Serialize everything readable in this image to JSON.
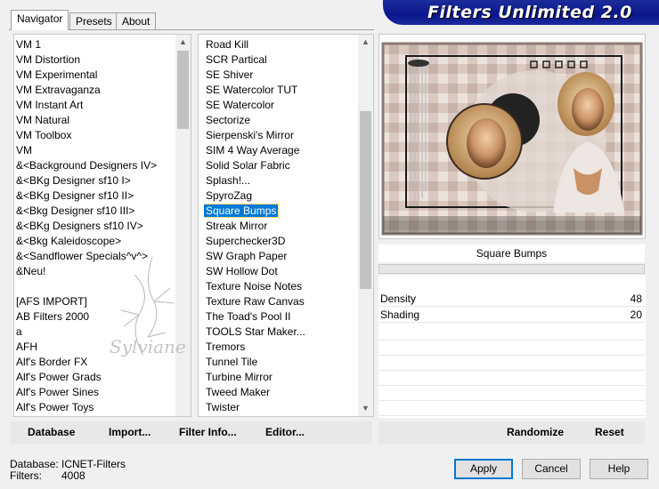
{
  "tabs": [
    "Navigator",
    "Presets",
    "About"
  ],
  "banner": "Filters Unlimited 2.0",
  "categories": [
    "VM 1",
    "VM Distortion",
    "VM Experimental",
    "VM Extravaganza",
    "VM Instant Art",
    "VM Natural",
    "VM Toolbox",
    "VM",
    "&<Background Designers IV>",
    "&<BKg Designer sf10 I>",
    "&<BKg Designer sf10 II>",
    "&<Bkg Designer sf10 III>",
    "&<BKg Designers sf10 IV>",
    "&<Bkg Kaleidoscope>",
    "&<Sandflower Specials^v^>",
    "&Neu!",
    "",
    "[AFS IMPORT]",
    "AB Filters 2000",
    "a",
    "AFH",
    "Alf's Border FX",
    "Alf's Power Grads",
    "Alf's Power Sines",
    "Alf's Power Toys"
  ],
  "filters": [
    "Road Kill",
    "SCR  Partical",
    "SE Shiver",
    "SE Watercolor TUT",
    "SE Watercolor",
    "Sectorize",
    "Sierpenski's Mirror",
    "SIM 4 Way Average",
    "Solid Solar Fabric",
    "Splash!...",
    "SpyroZag",
    "Square Bumps",
    "Streak Mirror",
    "Superchecker3D",
    "SW Graph Paper",
    "SW Hollow Dot",
    "Texture Noise Notes",
    "Texture Raw Canvas",
    "The Toad's Pool II",
    "TOOLS Star Maker...",
    "Tremors",
    "Tunnel Tile",
    "Turbine Mirror",
    "Tweed Maker",
    "Twister"
  ],
  "selected_filter_index": 11,
  "filter_name": "Square Bumps",
  "params": [
    {
      "label": "Density",
      "value": "48"
    },
    {
      "label": "Shading",
      "value": "20"
    }
  ],
  "toolbar": {
    "database": "Database",
    "import": "Import...",
    "filter_info": "Filter Info...",
    "editor": "Editor...",
    "randomize": "Randomize",
    "reset": "Reset"
  },
  "status": {
    "database_label": "Database:",
    "database_value": "ICNET-Filters",
    "filters_label": "Filters:",
    "filters_value": "4008"
  },
  "buttons": {
    "apply": "Apply",
    "cancel": "Cancel",
    "help": "Help"
  },
  "watermark": "Sylviane",
  "colors": {
    "selection": "#0078d7",
    "banner": "#0b168a"
  }
}
